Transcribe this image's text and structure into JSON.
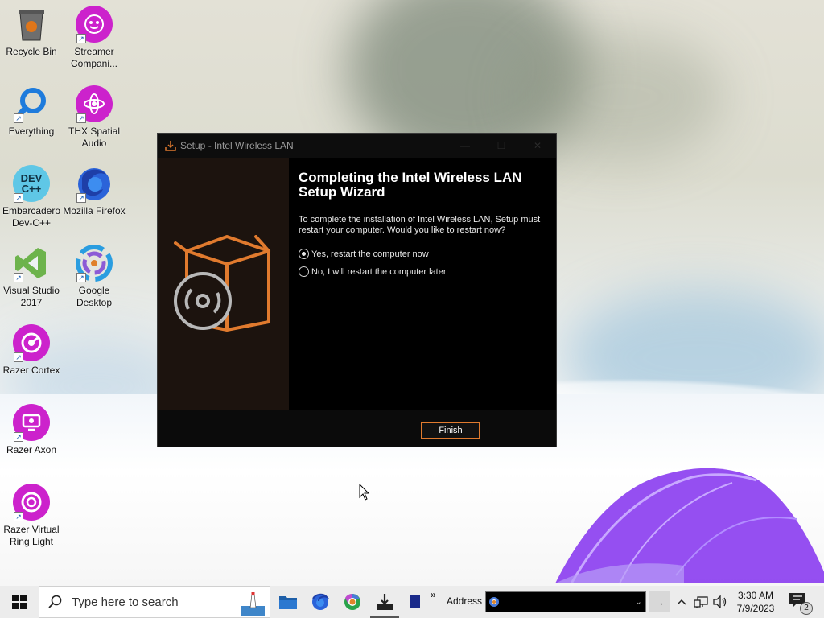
{
  "desktop": {
    "icons": [
      {
        "label": "Recycle Bin",
        "icon": "recycle-bin-icon"
      },
      {
        "label": "Streamer Compani...",
        "icon": "streamer-companion-icon"
      },
      {
        "label": "Everything",
        "icon": "everything-search-icon"
      },
      {
        "label": "THX Spatial Audio",
        "icon": "thx-spatial-audio-icon"
      },
      {
        "label": "Embarcadero Dev-C++",
        "icon": "dev-cpp-icon",
        "icon_text": "DEV C++"
      },
      {
        "label": "Mozilla Firefox",
        "icon": "firefox-icon"
      },
      {
        "label": "Visual Studio 2017",
        "icon": "visual-studio-icon"
      },
      {
        "label": "Google Desktop",
        "icon": "google-desktop-icon"
      },
      {
        "label": "Razer Cortex",
        "icon": "razer-cortex-icon"
      },
      {
        "label": "Razer Axon",
        "icon": "razer-axon-icon"
      },
      {
        "label": "Razer Virtual Ring Light",
        "icon": "razer-ring-light-icon"
      }
    ]
  },
  "setup_window": {
    "title": "Setup - Intel Wireless LAN",
    "heading": "Completing the Intel Wireless LAN Setup Wizard",
    "description": "To complete the installation of Intel Wireless LAN, Setup must restart your computer. Would you like to restart now?",
    "options": [
      {
        "label": "Yes, restart the computer now",
        "selected": true
      },
      {
        "label": "No, I will restart the computer later",
        "selected": false
      }
    ],
    "finish_label": "Finish",
    "controls": {
      "minimize": "—",
      "maximize": "☐",
      "close": "✕"
    },
    "accent_color": "#e07a2e"
  },
  "taskbar": {
    "search_placeholder": "Type here to search",
    "address_label": "Address",
    "address_value": "",
    "overflow_glyph": "»",
    "clock_time": "3:30 AM",
    "clock_date": "7/9/2023",
    "notification_count": "2",
    "pinned": [
      "file-explorer-icon",
      "firefox-icon",
      "chrome-icon",
      "setup-installer-icon",
      "app-icon"
    ]
  }
}
